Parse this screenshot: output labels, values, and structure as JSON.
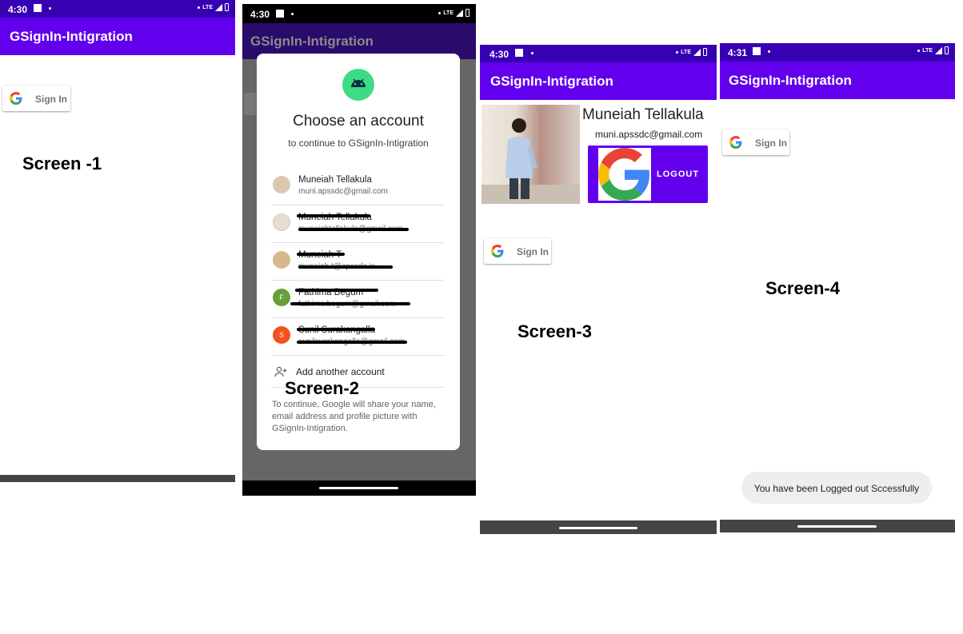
{
  "colors": {
    "primary": "#6200ee",
    "status_bar": "#3700b3",
    "scrim": "#666666",
    "nav": "#444444"
  },
  "screen1": {
    "status": {
      "time": "4:30",
      "network": "LTE"
    },
    "app_title": "GSignIn-Intigration",
    "signin_label": "Sign In",
    "label": "Screen -1"
  },
  "screen2": {
    "status": {
      "time": "4:30",
      "network": "LTE"
    },
    "app_title": "GSignIn-Intigration",
    "dialog": {
      "title": "Choose an account",
      "subtitle": "to continue to GSignIn-Intigration",
      "accounts": [
        {
          "name": "Muneiah Tellakula",
          "email": "muni.apssdc@gmail.com",
          "avatar_color": "#d9c7b0",
          "initial": ""
        },
        {
          "name": "Muneiah Tellakula",
          "email": "muneiahtellakula@gmail.com",
          "avatar_color": "#e8dccd",
          "initial": ""
        },
        {
          "name": "Muneiah T",
          "email": "muneiah.t@apssdc.in",
          "avatar_color": "#d6b98a",
          "initial": ""
        },
        {
          "name": "Fathima Begum",
          "email": "fathima.begum@gmail.com",
          "avatar_color": "#689f38",
          "initial": "F"
        },
        {
          "name": "Sunil Surakangalla",
          "email": "sunilsurakangalla@gmail.com",
          "avatar_color": "#f4511e",
          "initial": "S"
        }
      ],
      "add_account": "Add another account",
      "footer": "To continue, Google will share your name, email address and profile picture with GSignIn-Intigration."
    },
    "label": "Screen-2"
  },
  "screen3": {
    "status": {
      "time": "4:30",
      "network": "LTE"
    },
    "app_title": "GSignIn-Intigration",
    "profile_name": "Muneiah Tellakula",
    "profile_email": "muni.apssdc@gmail.com",
    "logout_label": "LOGOUT",
    "signin_label": "Sign In",
    "label": "Screen-3"
  },
  "screen4": {
    "status": {
      "time": "4:31",
      "network": "LTE"
    },
    "app_title": "GSignIn-Intigration",
    "signin_label": "Sign In",
    "toast": "You have been Logged out Sccessfully",
    "label": "Screen-4"
  }
}
